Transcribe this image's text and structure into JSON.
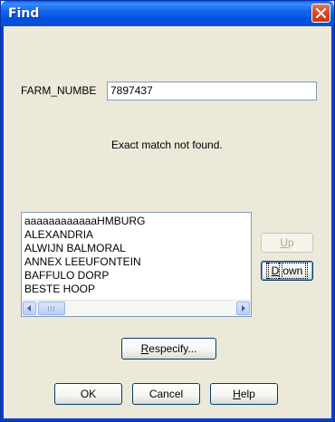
{
  "window": {
    "title": "Find"
  },
  "search": {
    "field_label": "FARM_NUMBE",
    "value": "7897437"
  },
  "status": {
    "message": "Exact match not found."
  },
  "results": {
    "items": [
      "aaaaaaaaaaaaHMBURG",
      "ALEXANDRIA",
      "ALWIJN BALMORAL",
      "ANNEX LEEUFONTEIN",
      "BAFFULO DORP",
      "BESTE HOOP"
    ]
  },
  "buttons": {
    "up": {
      "mn": "U",
      "rest": "p"
    },
    "down": {
      "mn": "D",
      "rest": "own"
    },
    "respecify": {
      "mn": "R",
      "rest": "especify..."
    },
    "ok": "OK",
    "cancel": "Cancel",
    "help": {
      "mn": "H",
      "rest": "elp"
    }
  },
  "colors": {
    "title_bar": "#0a5ee8",
    "dialog_bg": "#ece9d8",
    "close": "#d6441e"
  }
}
